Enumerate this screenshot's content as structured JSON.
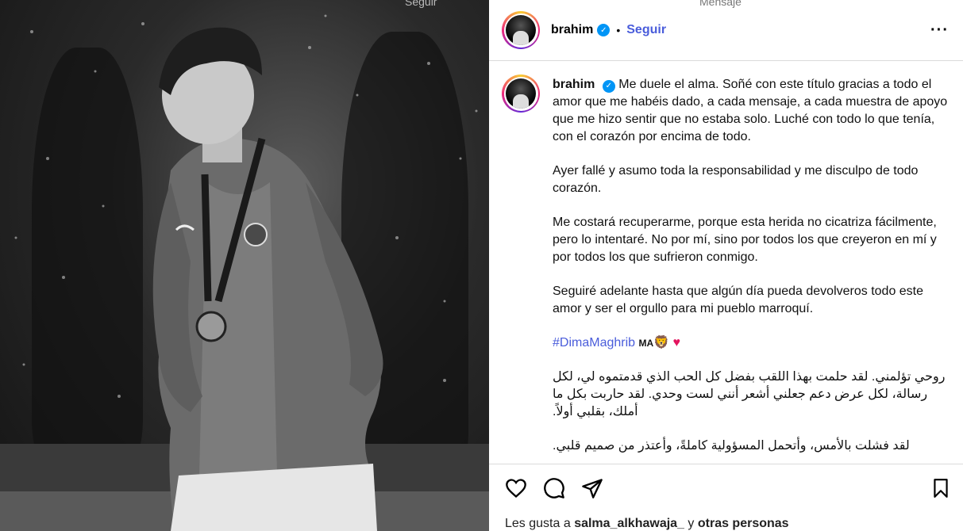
{
  "top_tabs": {
    "left": "Seguir",
    "right": "Mensaje"
  },
  "post": {
    "username": "brahim",
    "verified_mark": "✓",
    "separator": "•",
    "follow_label": "Seguir",
    "more_icon": "more-horizontal-icon",
    "more_glyph": "···"
  },
  "caption": {
    "username": "brahim",
    "p1": "Me duele el alma. Soñé con este título gracias a todo el amor que me habéis dado, a cada mensaje, a cada muestra de apoyo que me hizo sentir que no estaba solo. Luché con todo lo que tenía, con el corazón por encima de todo.",
    "p2": "Ayer fallé y asumo toda la responsabilidad y me disculpo de todo corazón.",
    "p3": "Me costará recuperarme, porque esta herida no cicatriza fácilmente, pero lo intentaré. No por mí, sino por todos los que creyeron en mí y por todos los que sufrieron conmigo.",
    "p4": "Seguiré adelante hasta que algún día pueda devolveros todo este amor y ser el orgullo para mi pueblo marroquí.",
    "hashtag": "#DimaMaghrib",
    "flag_text": "MA",
    "lion_emoji": "🦁",
    "heart_emoji": "♥",
    "ar1": "روحي تؤلمني. لقد حلمت بهذا اللقب بفضل كل الحب الذي قدمتموه لي، لكل رسالة، لكل عرض دعم جعلني أشعر أنني لست وحدي. لقد حاربت بكل ما أملك، بقلبي أولاً.",
    "ar2": "لقد فشلت بالأمس، وأتحمل المسؤولية كاملةً، وأعتذر من صميم قلبي."
  },
  "actions": {
    "like_icon": "heart-outline-icon",
    "comment_icon": "comment-icon",
    "share_icon": "send-icon",
    "save_icon": "bookmark-icon"
  },
  "likes": {
    "prefix": "Les gusta a",
    "user": "salma_alkhawaja_",
    "conj": "y",
    "others": "otras personas"
  }
}
